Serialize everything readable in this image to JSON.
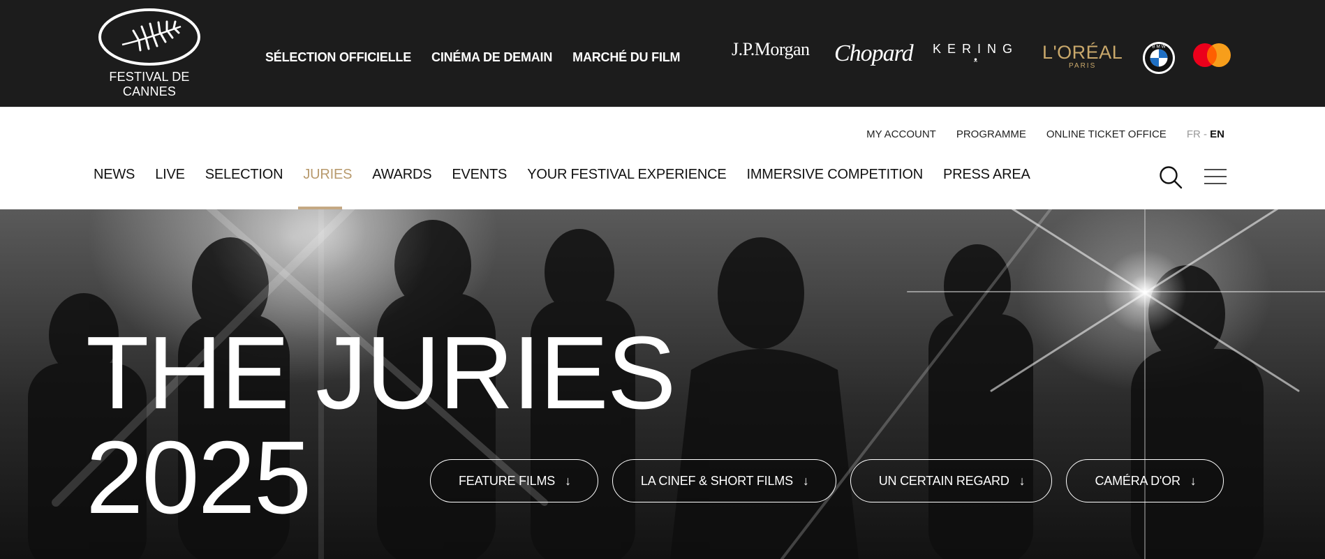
{
  "logo": {
    "text": "FESTIVAL DE CANNES"
  },
  "top_nav": [
    "SÉLECTION OFFICIELLE",
    "CINÉMA DE DEMAIN",
    "MARCHÉ DU FILM"
  ],
  "sponsors": {
    "jpmorgan": "J.P.Morgan",
    "chopard": "Chopard",
    "kering": "KERING",
    "loreal": "L'ORÉAL",
    "loreal_sub": "PARIS",
    "bmw": "BMW",
    "mastercard": "mastercard"
  },
  "util_nav": [
    "MY ACCOUNT",
    "PROGRAMME",
    "ONLINE TICKET OFFICE"
  ],
  "lang": {
    "fr": "FR",
    "sep": "-",
    "en": "EN"
  },
  "main_nav": [
    "NEWS",
    "LIVE",
    "SELECTION",
    "JURIES",
    "AWARDS",
    "EVENTS",
    "YOUR FESTIVAL EXPERIENCE",
    "IMMERSIVE COMPETITION",
    "PRESS AREA"
  ],
  "active_nav": "JURIES",
  "hero": {
    "title_line1": "THE JURIES",
    "title_line2": "2025",
    "buttons": [
      "FEATURE FILMS",
      "LA CINEF & SHORT FILMS",
      "UN CERTAIN REGARD",
      "CAMÉRA D'OR"
    ],
    "arrow": "↓"
  },
  "colors": {
    "topbar": "#1c1c1c",
    "active": "#b89a6d",
    "loreal_gold": "#c9a86b"
  }
}
